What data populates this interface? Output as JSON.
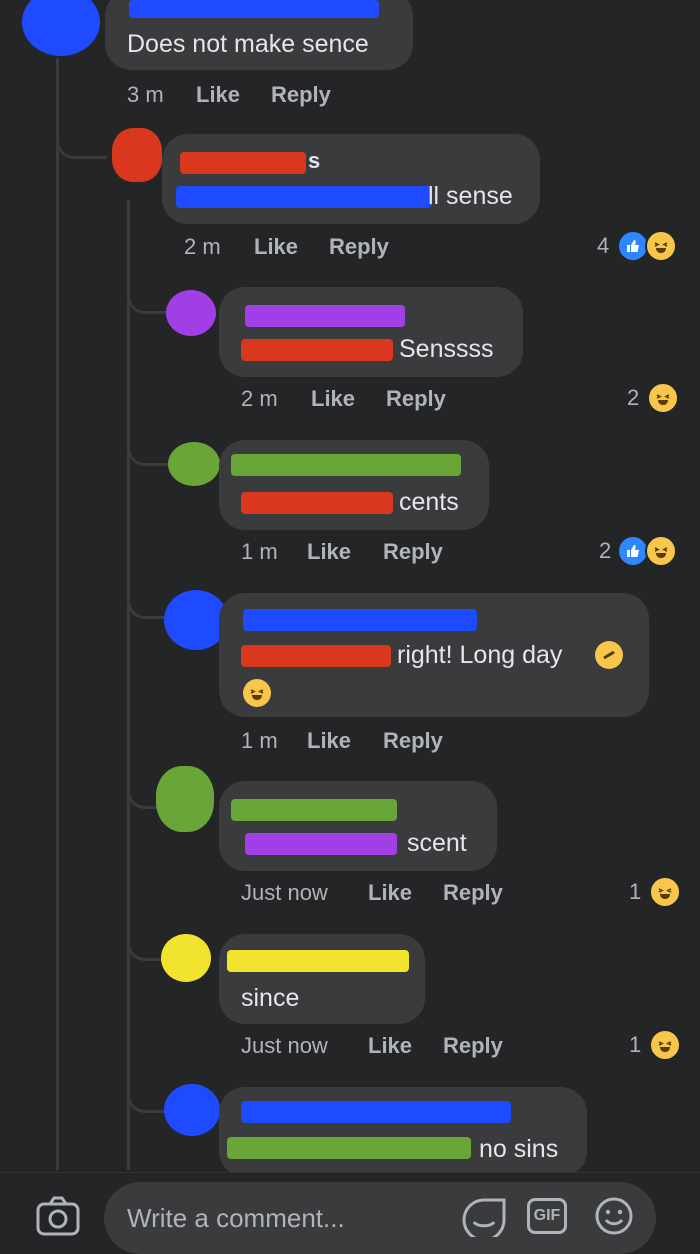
{
  "colors": {
    "background": "#242526",
    "bubble": "#3a3b3c",
    "text": "#e4e6eb",
    "meta": "#b0b3b8",
    "like_blue": "#2d88ff",
    "haha_yellow": "#f7c64a",
    "redact_blue": "#1e4bff",
    "redact_red": "#d9381e",
    "redact_purple": "#a23ee6",
    "redact_green": "#6aa537",
    "redact_yellow": "#f2e32e"
  },
  "comments": [
    {
      "text": "Does not make sence",
      "time": "3 m",
      "like": "Like",
      "reply": "Reply"
    },
    {
      "name_visible": "s",
      "text": "ll sense",
      "time": "2 m",
      "like": "Like",
      "reply": "Reply",
      "reaction_count": "4"
    },
    {
      "text": "Senssss",
      "time": "2 m",
      "like": "Like",
      "reply": "Reply",
      "reaction_count": "2"
    },
    {
      "text": "cents",
      "time": "1 m",
      "like": "Like",
      "reply": "Reply",
      "reaction_count": "2"
    },
    {
      "text": "right! Long day",
      "time": "1 m",
      "like": "Like",
      "reply": "Reply"
    },
    {
      "text": "scent",
      "time": "Just now",
      "like": "Like",
      "reply": "Reply",
      "reaction_count": "1"
    },
    {
      "text": "since",
      "time": "Just now",
      "like": "Like",
      "reply": "Reply",
      "reaction_count": "1"
    },
    {
      "text": "no sins"
    }
  ],
  "composer": {
    "placeholder": "Write a comment...",
    "gif_label": "GIF",
    "camera_icon": "camera-icon",
    "sticker_icon": "sticker-icon",
    "emoji_icon": "emoji-icon"
  }
}
